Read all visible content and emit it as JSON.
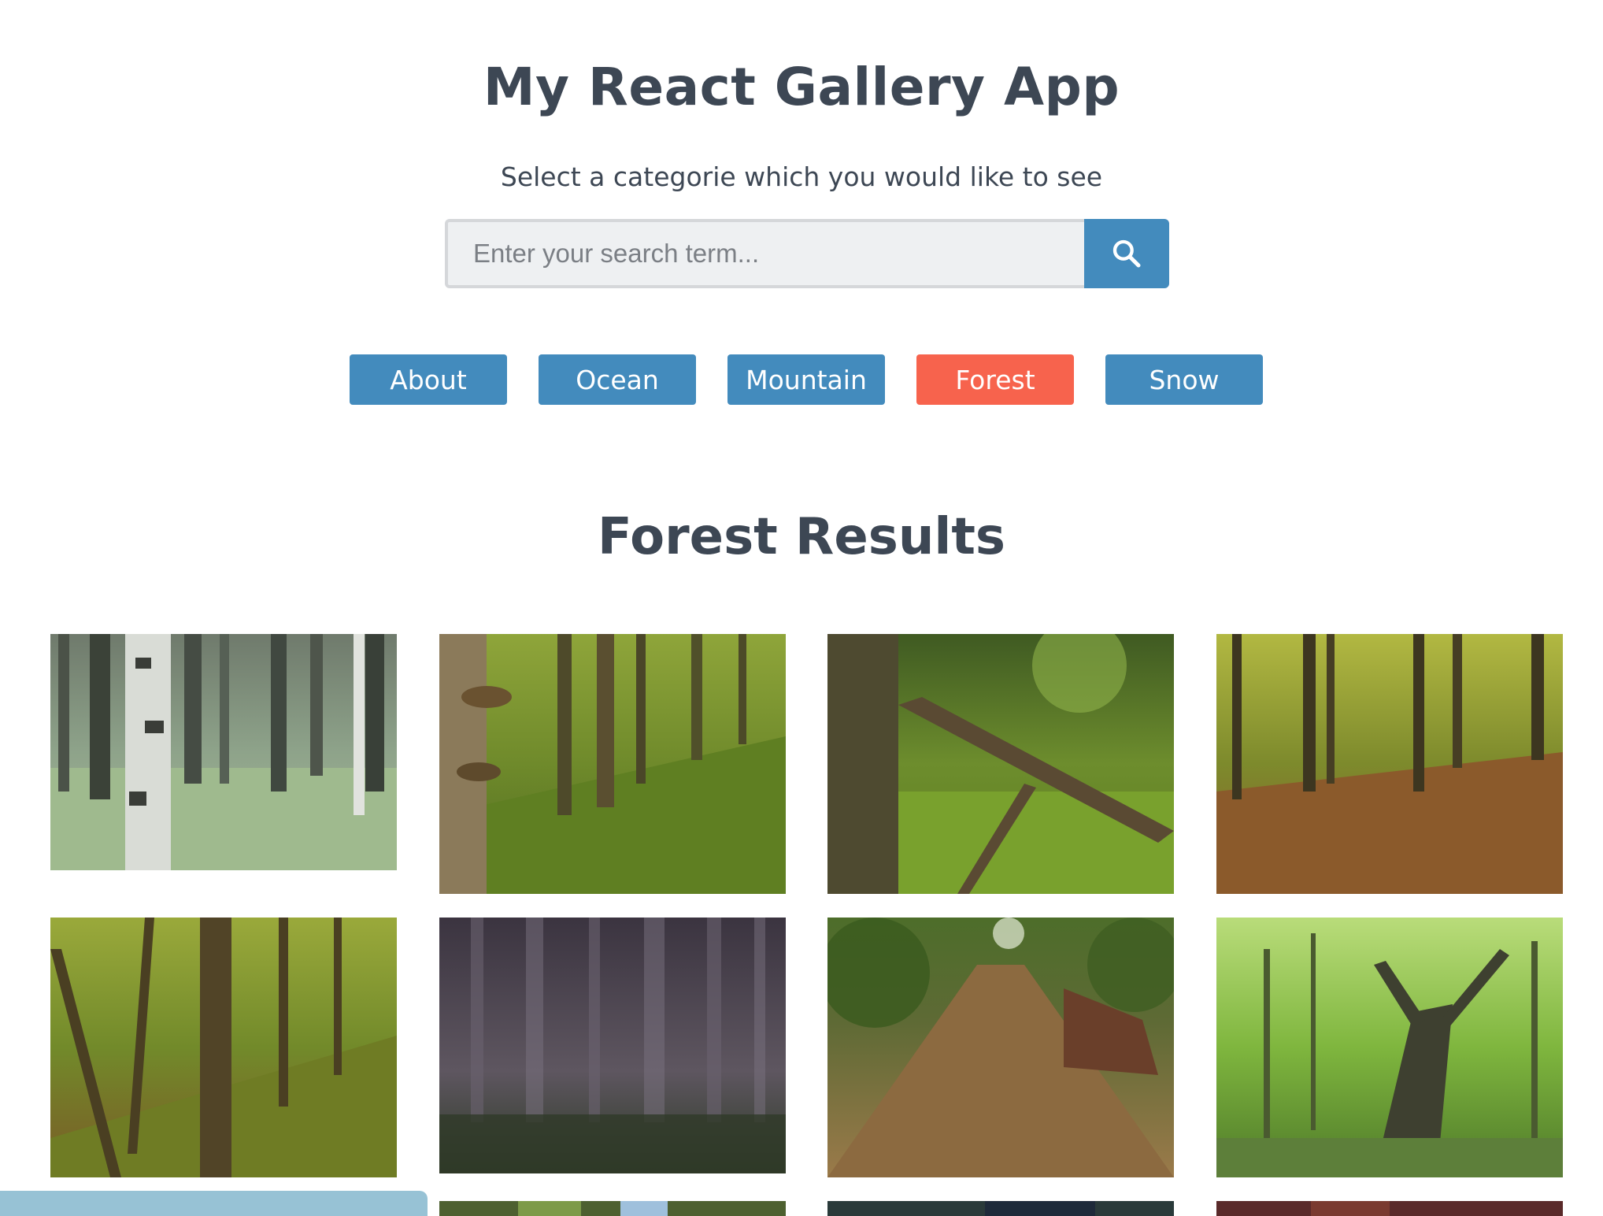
{
  "header": {
    "title": "My React Gallery App",
    "subtitle": "Select a categorie which you would like to see"
  },
  "search": {
    "placeholder": "Enter your search term...",
    "icon": "search-icon"
  },
  "nav": {
    "items": [
      {
        "label": "About"
      },
      {
        "label": "Ocean"
      },
      {
        "label": "Mountain"
      },
      {
        "label": "Forest",
        "active": true
      },
      {
        "label": "Snow"
      }
    ]
  },
  "results": {
    "title": "Forest Results"
  },
  "colors": {
    "accent": "#438bbd",
    "active": "#f7634d",
    "text": "#3d4754"
  }
}
